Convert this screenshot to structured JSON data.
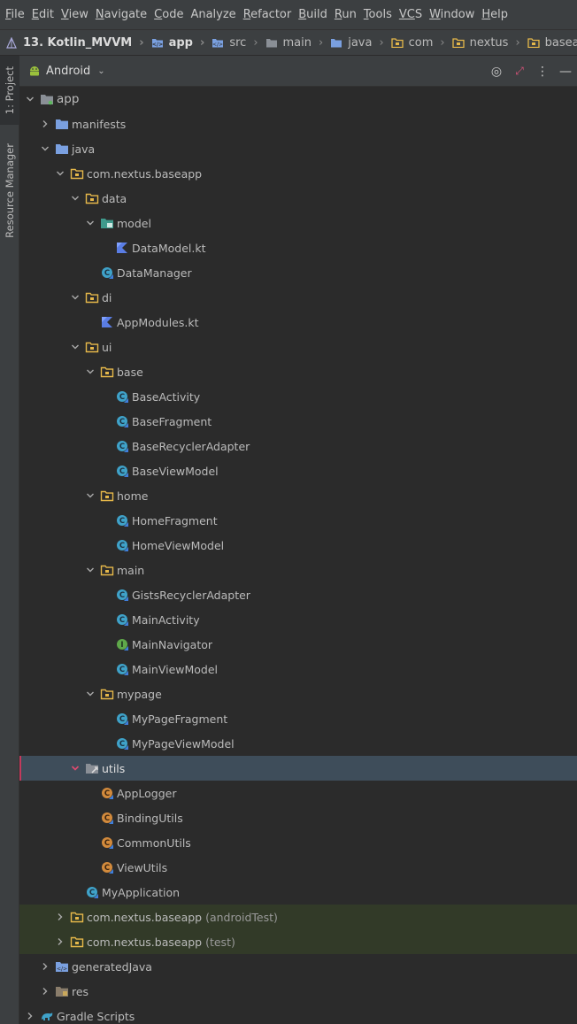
{
  "menu": [
    {
      "key": "F",
      "rest": "ile"
    },
    {
      "key": "E",
      "rest": "dit"
    },
    {
      "key": "V",
      "rest": "iew"
    },
    {
      "key": "N",
      "rest": "avigate"
    },
    {
      "key": "C",
      "rest": "ode"
    },
    {
      "key": "",
      "rest": "Analyze"
    },
    {
      "key": "R",
      "rest": "efactor"
    },
    {
      "key": "B",
      "rest": "uild"
    },
    {
      "key": "R",
      "rest": "un"
    },
    {
      "key": "T",
      "rest": "ools"
    },
    {
      "key": "VC",
      "rest": "S"
    },
    {
      "key": "W",
      "rest": "indow"
    },
    {
      "key": "H",
      "rest": "elp"
    }
  ],
  "breadcrumb": [
    "13. Kotlin_MVVM",
    "app",
    "src",
    "main",
    "java",
    "com",
    "nextus",
    "baseapp"
  ],
  "left_tabs": {
    "project": "1: Project",
    "resource_manager": "Resource Manager"
  },
  "view_selector": "Android",
  "header_icons": [
    "target-icon",
    "collapse-icon",
    "more-icon",
    "minimize-icon"
  ],
  "tree": [
    {
      "label": "app",
      "depth": 0,
      "arrow": "down",
      "icon": "module",
      "style": "appl"
    },
    {
      "label": "manifests",
      "depth": 1,
      "arrow": "right",
      "icon": "folder-blue"
    },
    {
      "label": "java",
      "depth": 1,
      "arrow": "down",
      "icon": "folder-blue"
    },
    {
      "label": "com.nextus.baseapp",
      "depth": 2,
      "arrow": "down",
      "icon": "package"
    },
    {
      "label": "data",
      "depth": 3,
      "arrow": "down",
      "icon": "package"
    },
    {
      "label": "model",
      "depth": 4,
      "arrow": "down",
      "icon": "package-teal"
    },
    {
      "label": "DataModel.kt",
      "depth": 5,
      "arrow": "none",
      "icon": "kotlin"
    },
    {
      "label": "DataManager",
      "depth": 4,
      "arrow": "none",
      "icon": "class-teal"
    },
    {
      "label": "di",
      "depth": 3,
      "arrow": "down",
      "icon": "package"
    },
    {
      "label": "AppModules.kt",
      "depth": 4,
      "arrow": "none",
      "icon": "kotlin"
    },
    {
      "label": "ui",
      "depth": 3,
      "arrow": "down",
      "icon": "package"
    },
    {
      "label": "base",
      "depth": 4,
      "arrow": "down",
      "icon": "package"
    },
    {
      "label": "BaseActivity",
      "depth": 5,
      "arrow": "none",
      "icon": "class-abstract"
    },
    {
      "label": "BaseFragment",
      "depth": 5,
      "arrow": "none",
      "icon": "class-abstract"
    },
    {
      "label": "BaseRecyclerAdapter",
      "depth": 5,
      "arrow": "none",
      "icon": "class-abstract"
    },
    {
      "label": "BaseViewModel",
      "depth": 5,
      "arrow": "none",
      "icon": "class-abstract"
    },
    {
      "label": "home",
      "depth": 4,
      "arrow": "down",
      "icon": "package"
    },
    {
      "label": "HomeFragment",
      "depth": 5,
      "arrow": "none",
      "icon": "class-teal"
    },
    {
      "label": "HomeViewModel",
      "depth": 5,
      "arrow": "none",
      "icon": "class-teal"
    },
    {
      "label": "main",
      "depth": 4,
      "arrow": "down",
      "icon": "package"
    },
    {
      "label": "GistsRecyclerAdapter",
      "depth": 5,
      "arrow": "none",
      "icon": "class-teal"
    },
    {
      "label": "MainActivity",
      "depth": 5,
      "arrow": "none",
      "icon": "class-teal"
    },
    {
      "label": "MainNavigator",
      "depth": 5,
      "arrow": "none",
      "icon": "interface-green"
    },
    {
      "label": "MainViewModel",
      "depth": 5,
      "arrow": "none",
      "icon": "class-teal"
    },
    {
      "label": "mypage",
      "depth": 4,
      "arrow": "down",
      "icon": "package"
    },
    {
      "label": "MyPageFragment",
      "depth": 5,
      "arrow": "none",
      "icon": "class-teal"
    },
    {
      "label": "MyPageViewModel",
      "depth": 5,
      "arrow": "none",
      "icon": "class-teal"
    },
    {
      "label": "utils",
      "depth": 3,
      "arrow": "down-red",
      "icon": "package-gray",
      "selected": true
    },
    {
      "label": "AppLogger",
      "depth": 4,
      "arrow": "none",
      "icon": "class-orange"
    },
    {
      "label": "BindingUtils",
      "depth": 4,
      "arrow": "none",
      "icon": "class-orange"
    },
    {
      "label": "CommonUtils",
      "depth": 4,
      "arrow": "none",
      "icon": "class-orange"
    },
    {
      "label": "ViewUtils",
      "depth": 4,
      "arrow": "none",
      "icon": "class-orange"
    },
    {
      "label": "MyApplication",
      "depth": 3,
      "arrow": "none",
      "icon": "class-teal"
    },
    {
      "label": "com.nextus.baseapp",
      "suffix": "(androidTest)",
      "depth": 2,
      "arrow": "right",
      "icon": "package",
      "test": true
    },
    {
      "label": "com.nextus.baseapp",
      "suffix": "(test)",
      "depth": 2,
      "arrow": "right",
      "icon": "package",
      "test": true
    },
    {
      "label": "generatedJava",
      "depth": 1,
      "arrow": "right",
      "icon": "folder-gen"
    },
    {
      "label": "res",
      "depth": 1,
      "arrow": "right",
      "icon": "folder-res"
    },
    {
      "label": "Gradle Scripts",
      "depth": 0,
      "arrow": "right",
      "icon": "gradle"
    }
  ],
  "colors": {
    "background": "#2b2b2b",
    "panel": "#3c3f41",
    "selection": "#3e4d5a",
    "selection_marker": "#c23a5c",
    "test_bg": "#323a28",
    "package_yellow": "#e6b84a",
    "folder_blue": "#7aa0e0",
    "class_teal": "#3fa2c9",
    "kotlin_blue": "#5a7de4"
  }
}
